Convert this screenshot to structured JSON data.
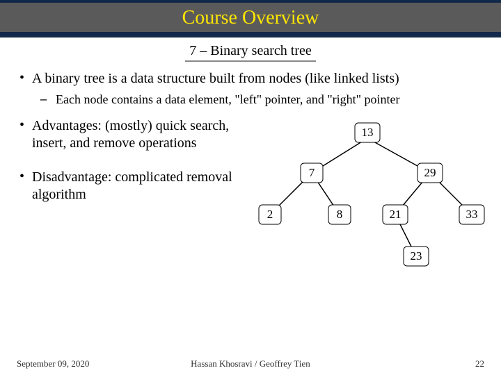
{
  "header": {
    "title": "Course Overview"
  },
  "subtitle": "7 – Binary search tree",
  "bullets": {
    "b1": {
      "dot": "•",
      "text": "A binary tree is a data structure built from nodes (like linked lists)"
    },
    "b1a": {
      "dash": "–",
      "text": "Each node contains a data element, \"left\" pointer, and \"right\" pointer"
    },
    "b2": {
      "dot": "•",
      "text": "Advantages: (mostly) quick search, insert, and remove operations"
    },
    "b3": {
      "dot": "•",
      "text": "Disadvantage: complicated removal algorithm"
    }
  },
  "tree": {
    "n13": "13",
    "n7": "7",
    "n29": "29",
    "n2": "2",
    "n8": "8",
    "n21": "21",
    "n33": "33",
    "n23": "23"
  },
  "footer": {
    "date": "September 09, 2020",
    "authors": "Hassan Khosravi / Geoffrey Tien",
    "page": "22"
  }
}
